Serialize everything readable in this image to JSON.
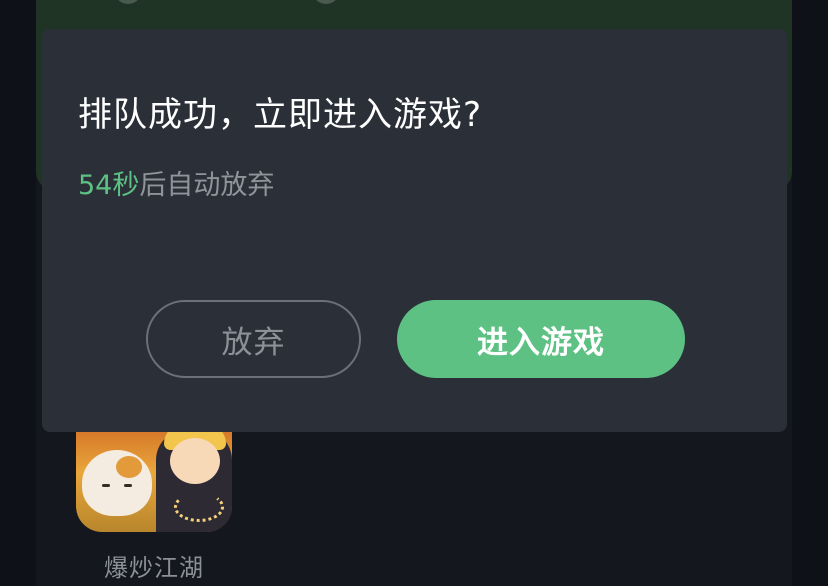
{
  "dialog": {
    "title": "排队成功，立即进入游戏?",
    "countdown_value": "54秒",
    "countdown_suffix": "后自动放弃",
    "abandon_label": "放弃",
    "enter_label": "进入游戏"
  },
  "game": {
    "name": "爆炒江湖"
  },
  "colors": {
    "accent": "#5ec184",
    "dialog_bg": "#2b2f38",
    "page_bg": "#11141b"
  }
}
